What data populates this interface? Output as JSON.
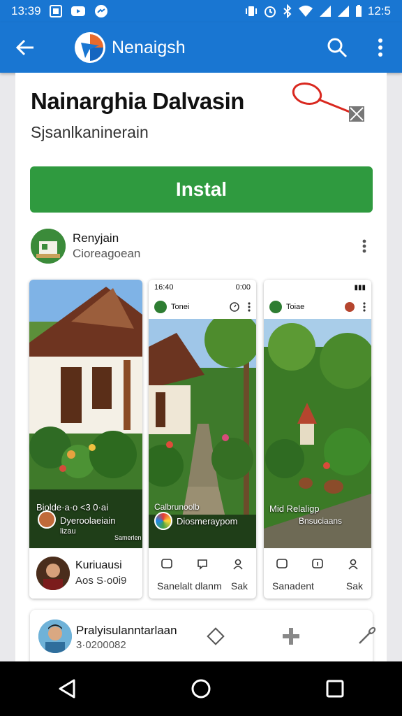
{
  "status": {
    "time": "13:39",
    "clock": "12:5",
    "left_icons": [
      "news-icon",
      "youtube-icon",
      "messenger-icon"
    ],
    "right_icons": [
      "vibrate-icon",
      "alarm-icon",
      "bluetooth-icon",
      "wifi-icon",
      "signal-icon",
      "signal-icon",
      "battery-icon"
    ]
  },
  "appbar": {
    "title": "Nenaigsh",
    "color": "#1976d2",
    "icons": [
      "back-icon",
      "app-logo-icon",
      "search-icon",
      "more-vert-icon"
    ]
  },
  "app": {
    "title": "Nainarghia Dalvasin",
    "subtitle": "Sjsanlkaninerain",
    "install_label": "Instal",
    "install_color": "#2f9a3f"
  },
  "developer": {
    "name": "Renyjain",
    "sub": "Cioreagoean"
  },
  "screenshots": [
    {
      "overlay_title": "Biolde·a·o <3 0·ai",
      "overlay_name": "Dyeroolaeiain",
      "overlay_sub": "lizau",
      "overlay_tag": "Samerlen",
      "user_name": "Kuriuausi",
      "user_sub": "Aos  S·o0i9"
    },
    {
      "status_time": "16:40",
      "status_right": "0:00",
      "header": "Tonei",
      "overlay_title": "Calbrunoolb",
      "overlay_name": "Diosmeraypom",
      "tab_left": "Sanelalt dlanm",
      "tab_right": "Sak"
    },
    {
      "header": "Toiae",
      "overlay_title": "Mid Relaligp",
      "overlay_name": "Bnsuciaans",
      "tab_left": "Sanadent",
      "tab_right": "Sak"
    }
  ],
  "review": {
    "name": "Pralyisulanntarlaan",
    "sub": "3·0200082",
    "icons": [
      "diamond-icon",
      "plus-icon",
      "pen-icon"
    ]
  },
  "navbar": {
    "icons": [
      "back-triangle-icon",
      "home-circle-icon",
      "recents-square-icon"
    ]
  }
}
